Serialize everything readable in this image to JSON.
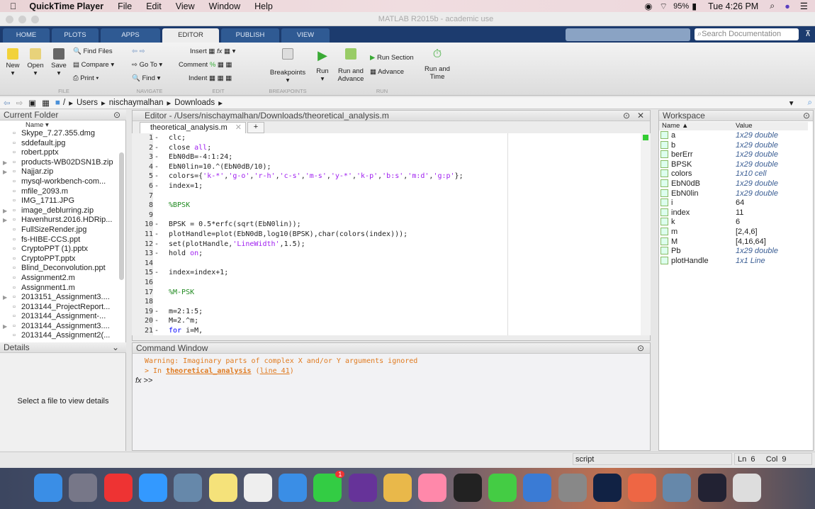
{
  "menubar": {
    "app": "QuickTime Player",
    "items": [
      "File",
      "Edit",
      "View",
      "Window",
      "Help"
    ],
    "battery": "95%",
    "clock": "Tue 4:26 PM"
  },
  "window_title": "MATLAB R2015b - academic use",
  "tabs": [
    "HOME",
    "PLOTS",
    "APPS",
    "EDITOR",
    "PUBLISH",
    "VIEW"
  ],
  "search_placeholder": "Search Documentation",
  "toolstrip": {
    "new": "New",
    "open": "Open",
    "save": "Save",
    "find_files": "Find Files",
    "compare": "Compare",
    "print": "Print",
    "go_to": "Go To",
    "find": "Find",
    "insert": "Insert",
    "comment": "Comment",
    "indent": "Indent",
    "breakpoints": "Breakpoints",
    "run": "Run",
    "run_and_advance": "Run and Advance",
    "run_section": "Run Section",
    "advance": "Advance",
    "run_and_time": "Run and Time",
    "sections": [
      "FILE",
      "NAVIGATE",
      "EDIT",
      "BREAKPOINTS",
      "RUN"
    ]
  },
  "address": [
    "/",
    "Users",
    "nischaymalhan",
    "Downloads"
  ],
  "current_folder": {
    "title": "Current Folder",
    "col": "Name ▾",
    "files": [
      {
        "name": "Skype_7.27.355.dmg",
        "exp": false
      },
      {
        "name": "sddefault.jpg",
        "exp": false
      },
      {
        "name": "robert.pptx",
        "exp": false
      },
      {
        "name": "products-WB02DSN1B.zip",
        "exp": true
      },
      {
        "name": "Najjar.zip",
        "exp": true
      },
      {
        "name": "mysql-workbench-com...",
        "exp": false
      },
      {
        "name": "mfile_2093.m",
        "exp": false
      },
      {
        "name": "IMG_1711.JPG",
        "exp": false
      },
      {
        "name": "image_deblurring.zip",
        "exp": true
      },
      {
        "name": "Havenhurst.2016.HDRip...",
        "exp": true
      },
      {
        "name": "FullSizeRender.jpg",
        "exp": false
      },
      {
        "name": "fs-HIBE-CCS.ppt",
        "exp": false
      },
      {
        "name": "CryptoPPT (1).pptx",
        "exp": false
      },
      {
        "name": "CryptoPPT.pptx",
        "exp": false
      },
      {
        "name": "Blind_Deconvolution.ppt",
        "exp": false
      },
      {
        "name": "Assignment2.m",
        "exp": false
      },
      {
        "name": "Assignment1.m",
        "exp": false
      },
      {
        "name": "2013151_Assignment3....",
        "exp": true
      },
      {
        "name": "2013144_ProjectReport...",
        "exp": false
      },
      {
        "name": "2013144_Assignment-...",
        "exp": false
      },
      {
        "name": "2013144_Assignment3....",
        "exp": true
      },
      {
        "name": "2013144_Assignment2(...",
        "exp": false
      }
    ]
  },
  "details": {
    "title": "Details",
    "message": "Select a file to view details"
  },
  "editor": {
    "title": "Editor - /Users/nischaymalhan/Downloads/theoretical_analysis.m",
    "tab": "theoretical_analysis.m",
    "lines": [
      {
        "n": "1",
        "m": "-",
        "s": [
          [
            "clc;",
            ""
          ]
        ]
      },
      {
        "n": "2",
        "m": "-",
        "s": [
          [
            "close ",
            ""
          ],
          [
            "all",
            "str"
          ],
          [
            ";",
            ""
          ]
        ]
      },
      {
        "n": "3",
        "m": "-",
        "s": [
          [
            "EbN0dB=-4:1:24;",
            ""
          ]
        ]
      },
      {
        "n": "4",
        "m": "-",
        "s": [
          [
            "EbN0lin=10.^(EbN0dB/10);",
            ""
          ]
        ]
      },
      {
        "n": "5",
        "m": "-",
        "s": [
          [
            "colors={",
            ""
          ],
          [
            "'k-*'",
            "str"
          ],
          [
            ",",
            ""
          ],
          [
            "'g-o'",
            "str"
          ],
          [
            ",",
            ""
          ],
          [
            "'r-h'",
            "str"
          ],
          [
            ",",
            ""
          ],
          [
            "'c-s'",
            "str"
          ],
          [
            ",",
            ""
          ],
          [
            "'m-s'",
            "str"
          ],
          [
            ",",
            ""
          ],
          [
            "'y-*'",
            "str"
          ],
          [
            ",",
            ""
          ],
          [
            "'k-p'",
            "str"
          ],
          [
            ",",
            ""
          ],
          [
            "'b:s'",
            "str"
          ],
          [
            ",",
            ""
          ],
          [
            "'m:d'",
            "str"
          ],
          [
            ",",
            ""
          ],
          [
            "'g:p'",
            "str"
          ],
          [
            "};",
            ""
          ]
        ]
      },
      {
        "n": "6",
        "m": "-",
        "s": [
          [
            "index=1;",
            ""
          ]
        ]
      },
      {
        "n": "7",
        "m": "",
        "s": []
      },
      {
        "n": "8",
        "m": "",
        "s": [
          [
            "%BPSK",
            "cm"
          ]
        ]
      },
      {
        "n": "9",
        "m": "",
        "s": []
      },
      {
        "n": "10",
        "m": "-",
        "s": [
          [
            "BPSK = 0.5*erfc(sqrt(EbN0lin));",
            ""
          ]
        ]
      },
      {
        "n": "11",
        "m": "-",
        "s": [
          [
            "plotHandle=plot(EbN0dB,log10(BPSK),char(colors(index)));",
            ""
          ]
        ]
      },
      {
        "n": "12",
        "m": "-",
        "s": [
          [
            "set(plotHandle,",
            ""
          ],
          [
            "'LineWidth'",
            "str"
          ],
          [
            ",1.5);",
            ""
          ]
        ]
      },
      {
        "n": "13",
        "m": "-",
        "s": [
          [
            "hold ",
            ""
          ],
          [
            "on",
            "str"
          ],
          [
            ";",
            ""
          ]
        ]
      },
      {
        "n": "14",
        "m": "",
        "s": []
      },
      {
        "n": "15",
        "m": "-",
        "s": [
          [
            "index=index+1;",
            ""
          ]
        ]
      },
      {
        "n": "16",
        "m": "",
        "s": []
      },
      {
        "n": "17",
        "m": "",
        "s": [
          [
            "%M-PSK",
            "cm"
          ]
        ]
      },
      {
        "n": "18",
        "m": "",
        "s": []
      },
      {
        "n": "19",
        "m": "-",
        "s": [
          [
            "m=2:1:5;",
            ""
          ]
        ]
      },
      {
        "n": "20",
        "m": "-",
        "s": [
          [
            "M=2.^m;",
            ""
          ]
        ]
      },
      {
        "n": "21",
        "m": "-",
        "s": [
          [
            "for",
            "kw"
          ],
          [
            " i=M,",
            ""
          ]
        ]
      }
    ]
  },
  "command_window": {
    "title": "Command Window",
    "warning": "Warning: Imaginary parts of complex X and/or Y arguments ignored",
    "in_prefix": "> In ",
    "in_link": "theoretical_analysis",
    "line_prefix": " (",
    "line_link": "line 41",
    "line_suffix": ")",
    "prompt": ">>"
  },
  "workspace": {
    "title": "Workspace",
    "cols": [
      "Name ▲",
      "Value"
    ],
    "vars": [
      {
        "name": "a",
        "value": "1x29 double",
        "it": true
      },
      {
        "name": "b",
        "value": "1x29 double",
        "it": true
      },
      {
        "name": "berErr",
        "value": "1x29 double",
        "it": true
      },
      {
        "name": "BPSK",
        "value": "1x29 double",
        "it": true
      },
      {
        "name": "colors",
        "value": "1x10 cell",
        "it": true
      },
      {
        "name": "EbN0dB",
        "value": "1x29 double",
        "it": true
      },
      {
        "name": "EbN0lin",
        "value": "1x29 double",
        "it": true
      },
      {
        "name": "i",
        "value": "64",
        "it": false
      },
      {
        "name": "index",
        "value": "11",
        "it": false
      },
      {
        "name": "k",
        "value": "6",
        "it": false
      },
      {
        "name": "m",
        "value": "[2,4,6]",
        "it": false
      },
      {
        "name": "M",
        "value": "[4,16,64]",
        "it": false
      },
      {
        "name": "Pb",
        "value": "1x29 double",
        "it": true
      },
      {
        "name": "plotHandle",
        "value": "1x1 Line",
        "it": true
      }
    ]
  },
  "status": {
    "type": "script",
    "ln_label": "Ln",
    "ln": "6",
    "col_label": "Col",
    "col": "9"
  },
  "dock": {
    "badge": "1",
    "apps": [
      "finder",
      "launchpad",
      "chrome",
      "safari",
      "mail",
      "notes",
      "reminders",
      "messages",
      "facetime",
      "siri",
      "pages",
      "photos",
      "terminal",
      "numbers",
      "keynote",
      "system-preferences",
      "steam",
      "matlab",
      "preview",
      "quicktime",
      "trash"
    ]
  },
  "colors": {
    "tab_strip": "#1c3b6e",
    "keyword": "#0000ff",
    "string": "#a020f0",
    "comment": "#228b22",
    "warning": "#e07b20"
  }
}
